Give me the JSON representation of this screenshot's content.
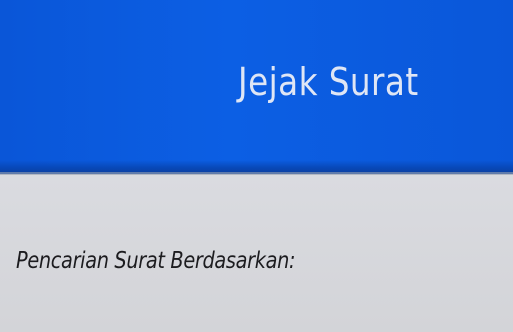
{
  "header": {
    "title": "Jejak Surat",
    "background_color": "#0a56d8",
    "title_color": "#dfe6f5"
  },
  "main": {
    "search_label": "Pencarian Surat Berdasarkan:",
    "background_color": "#d6d8dc"
  }
}
